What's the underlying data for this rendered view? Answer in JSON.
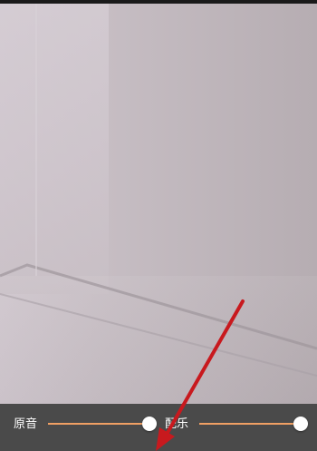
{
  "audio_mix": {
    "original_sound": {
      "label": "原音",
      "level": 1.0
    },
    "background_music": {
      "label": "配乐",
      "level": 1.0
    }
  },
  "colors": {
    "slider_track": "#f0a064",
    "thumb": "#ffffff",
    "bottom_bar": "#4a4a4a",
    "annotation_arrow": "#c8191e"
  }
}
